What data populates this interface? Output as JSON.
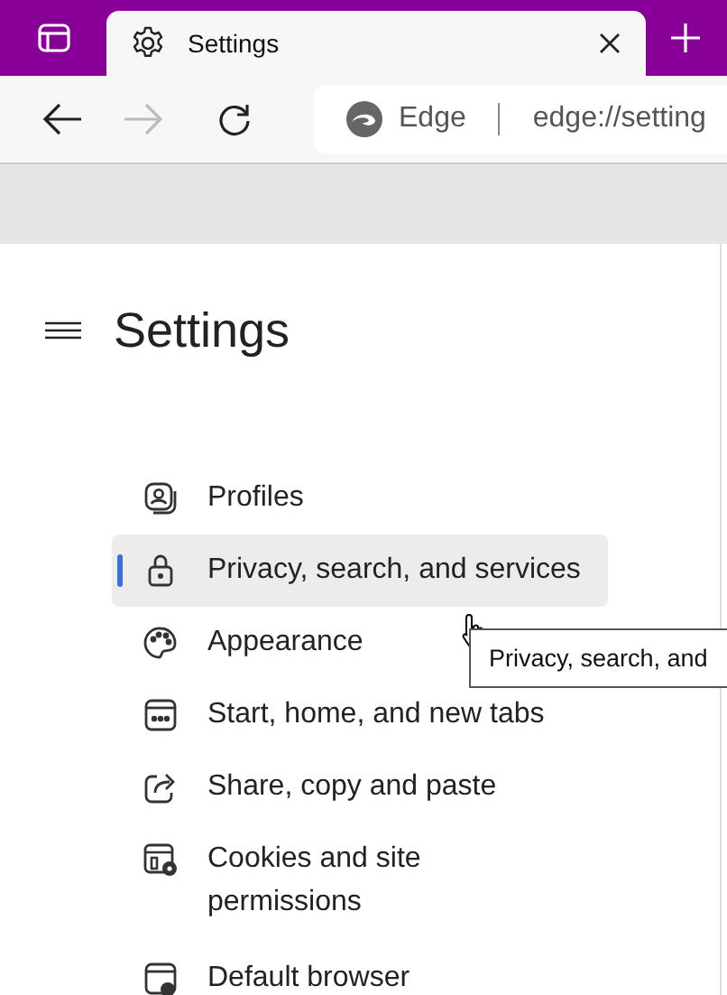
{
  "tab": {
    "title": "Settings"
  },
  "address": {
    "site": "Edge",
    "url": "edge://setting"
  },
  "page": {
    "title": "Settings"
  },
  "menu": [
    {
      "label": "Profiles",
      "kind": "profile",
      "selected": false
    },
    {
      "label": "Privacy, search, and services",
      "kind": "lock",
      "selected": true
    },
    {
      "label": "Appearance",
      "kind": "palette",
      "selected": false
    },
    {
      "label": "Start, home, and new tabs",
      "kind": "home",
      "selected": false
    },
    {
      "label": "Share, copy and paste",
      "kind": "share",
      "selected": false
    },
    {
      "label": "Cookies and site permissions",
      "kind": "cookies",
      "selected": false
    },
    {
      "label": "Default browser",
      "kind": "browser",
      "selected": false
    }
  ],
  "tooltip": "Privacy, search, and"
}
